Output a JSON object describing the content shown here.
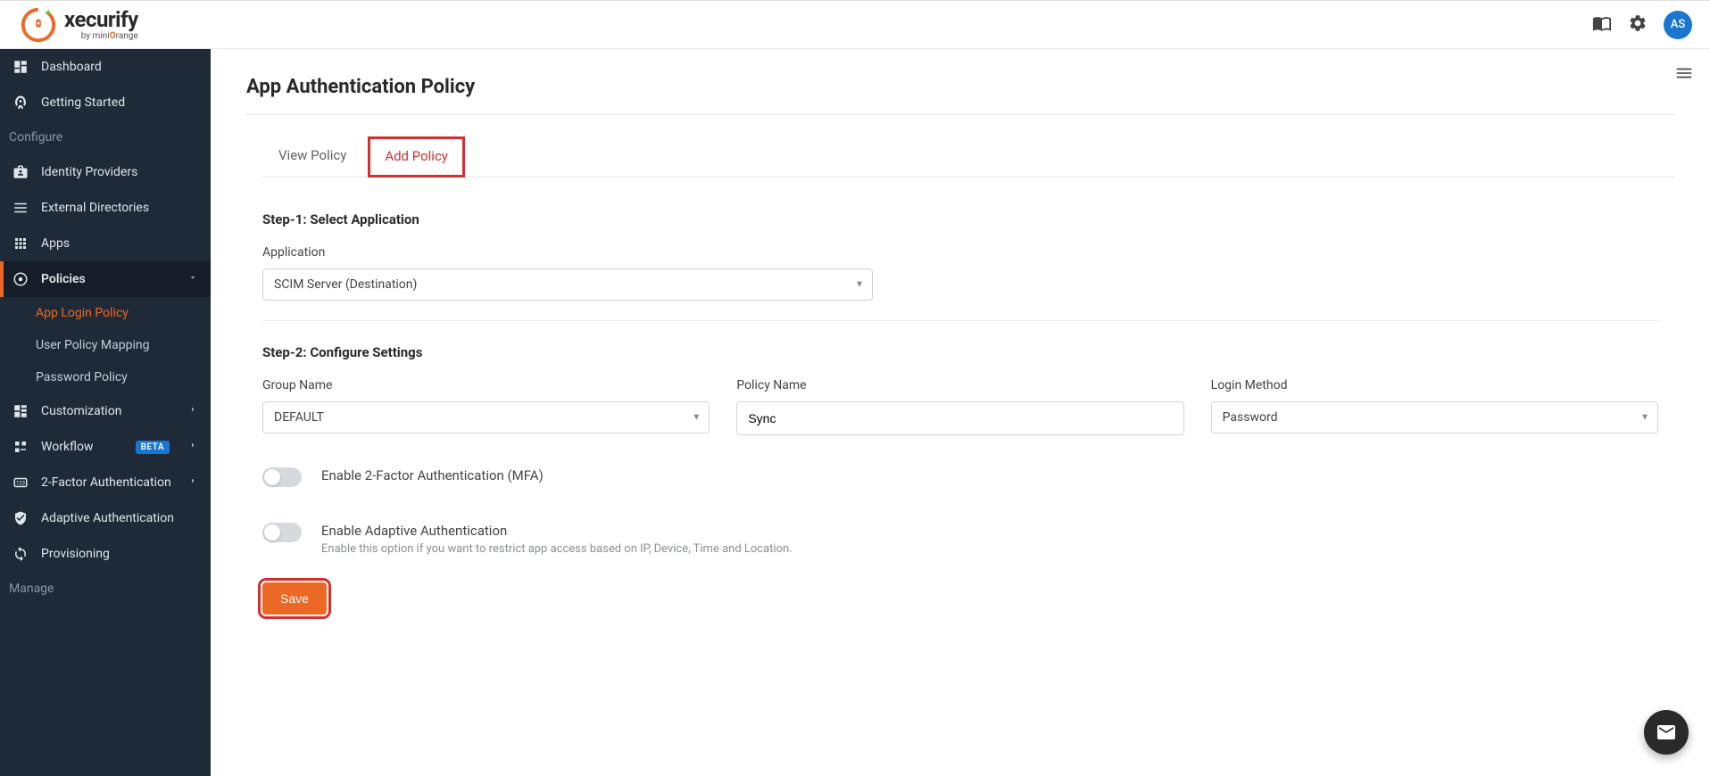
{
  "header": {
    "brand_name": "xecurify",
    "brand_sub_prefix": "by mini",
    "brand_sub_brand": "range",
    "avatar_initials": "AS"
  },
  "sidebar": {
    "items": [
      {
        "label": "Dashboard"
      },
      {
        "label": "Getting Started"
      }
    ],
    "section_configure": "Configure",
    "configure_items": [
      {
        "label": "Identity Providers"
      },
      {
        "label": "External Directories"
      },
      {
        "label": "Apps"
      },
      {
        "label": "Policies"
      }
    ],
    "policies_sub": [
      {
        "label": "App Login Policy"
      },
      {
        "label": "User Policy Mapping"
      },
      {
        "label": "Password Policy"
      }
    ],
    "more_items": [
      {
        "label": "Customization"
      },
      {
        "label": "Workflow",
        "badge": "BETA"
      },
      {
        "label": "2-Factor Authentication"
      },
      {
        "label": "Adaptive Authentication"
      },
      {
        "label": "Provisioning"
      }
    ],
    "section_manage": "Manage"
  },
  "main": {
    "title": "App Authentication Policy",
    "tabs": [
      {
        "label": "View Policy"
      },
      {
        "label": "Add Policy"
      }
    ],
    "step1_label": "Step-1: Select Application",
    "application_label": "Application",
    "application_value": "SCIM Server (Destination)",
    "step2_label": "Step-2: Configure Settings",
    "group_name_label": "Group Name",
    "group_name_value": "DEFAULT",
    "policy_name_label": "Policy Name",
    "policy_name_value": "Sync",
    "login_method_label": "Login Method",
    "login_method_value": "Password",
    "mfa_toggle_label": "Enable 2-Factor Authentication (MFA)",
    "adaptive_toggle_label": "Enable Adaptive Authentication",
    "adaptive_toggle_sub": "Enable this option if you want to restrict app access based on IP, Device, Time and Location.",
    "save_label": "Save"
  }
}
